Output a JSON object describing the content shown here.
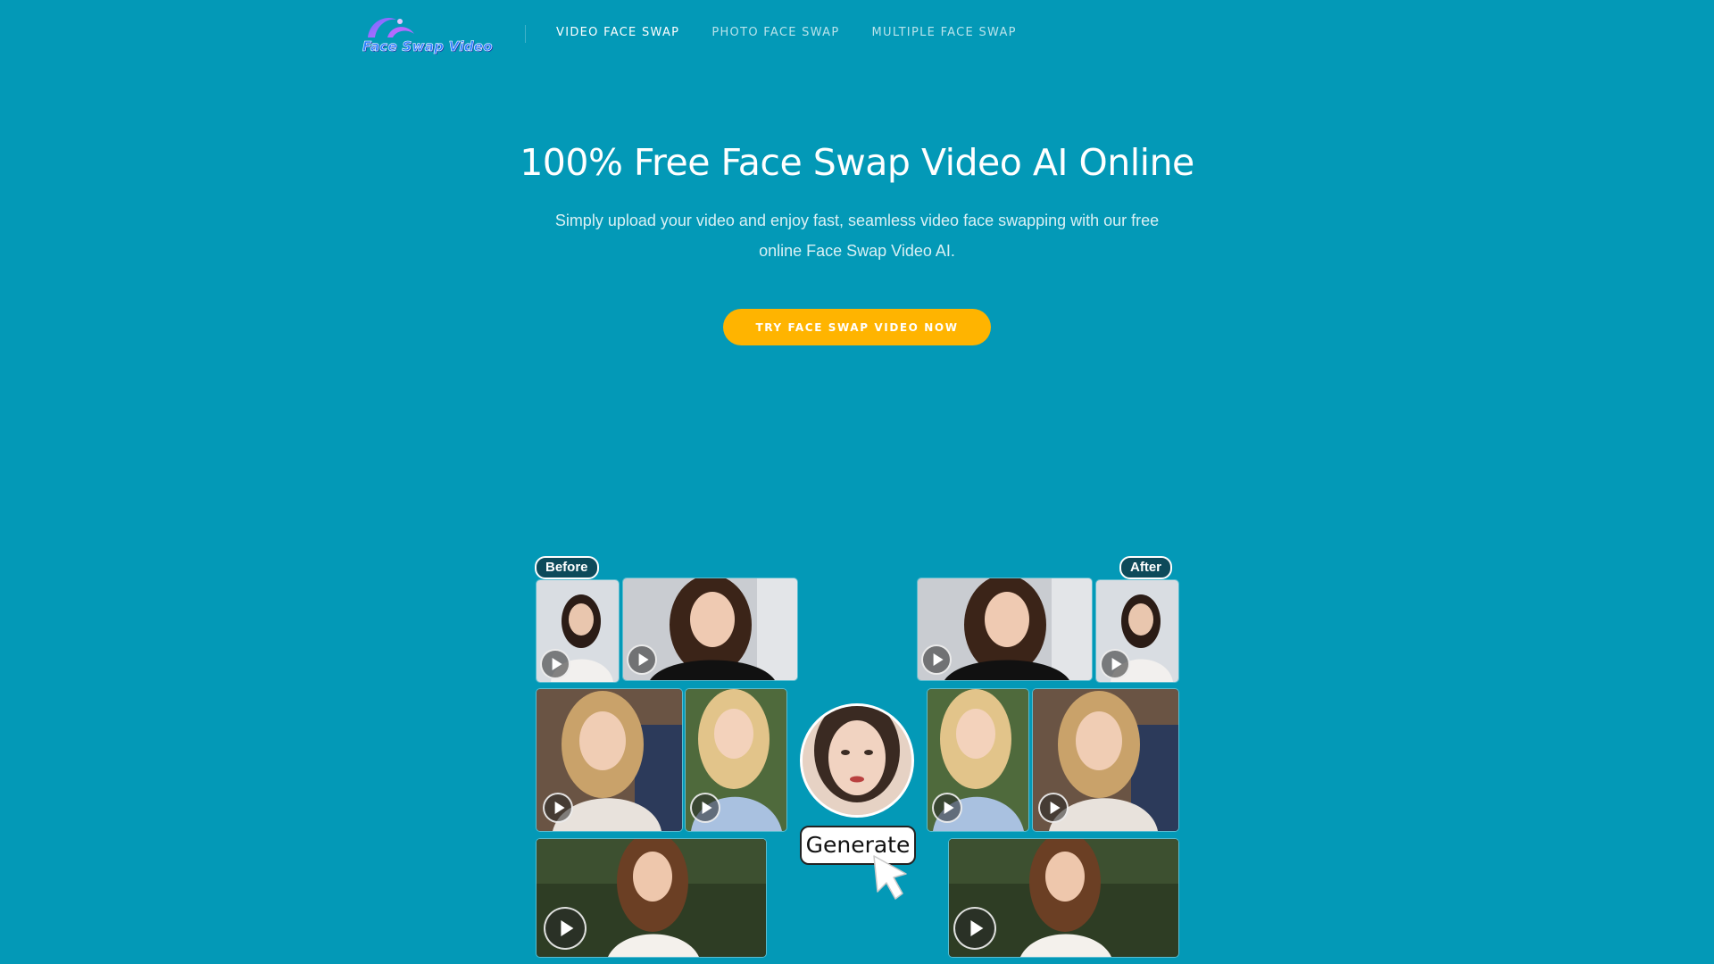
{
  "brand": {
    "logo_text": "Face Swap Video"
  },
  "nav": {
    "links": [
      {
        "label": "VIDEO FACE SWAP",
        "active": true
      },
      {
        "label": "PHOTO FACE SWAP",
        "active": false
      },
      {
        "label": "MULTIPLE FACE SWAP",
        "active": false
      }
    ]
  },
  "hero": {
    "title": "100% Free Face Swap Video AI Online",
    "subtitle": "Simply upload your video and enjoy fast, seamless video face swapping with our free online Face Swap Video AI.",
    "cta_label": "TRY FACE SWAP VIDEO NOW"
  },
  "showcase": {
    "before_label": "Before",
    "after_label": "After",
    "generate_label": "Generate",
    "icons": {
      "play": "play-icon",
      "cursor": "cursor-arrow-icon"
    }
  },
  "colors": {
    "background": "#0399b7",
    "cta": "#ffb400",
    "tag_bg": "#0d4a5a",
    "logo_accent": "#2b7fff"
  }
}
